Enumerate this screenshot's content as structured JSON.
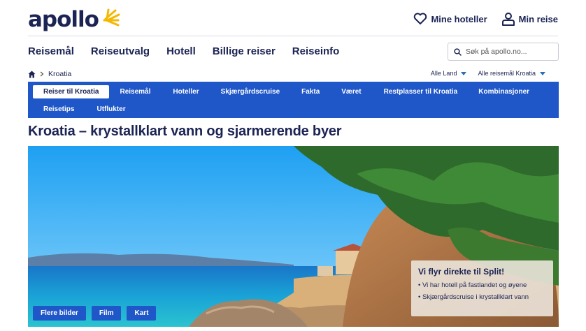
{
  "brand": {
    "name": "apollo"
  },
  "top_actions": [
    {
      "label": "Mine hoteller",
      "icon": "heart-icon"
    },
    {
      "label": "Min reise",
      "icon": "user-icon"
    }
  ],
  "main_nav": [
    "Reisemål",
    "Reiseutvalg",
    "Hotell",
    "Billige reiser",
    "Reiseinfo"
  ],
  "search": {
    "placeholder": "Søk på apollo.no..."
  },
  "breadcrumb": {
    "current": "Kroatia"
  },
  "filters": {
    "country": "Alle Land",
    "destination": "Alle reisemål Kroatia"
  },
  "sub_nav": {
    "row1": [
      "Reiser til Kroatia",
      "Reisemål",
      "Hoteller",
      "Skjærgårdscruise",
      "Fakta",
      "Været",
      "Restplasser til Kroatia",
      "Kombinasjoner"
    ],
    "row2": [
      "Reisetips",
      "Utflukter"
    ]
  },
  "page_title": "Kroatia – krystallklart vann og sjarmerende byer",
  "hero": {
    "buttons": [
      "Flere bilder",
      "Film",
      "Kart"
    ],
    "promo": {
      "title": "Vi flyr direkte til Split!",
      "items": [
        "Vi har hotell på fastlandet og øyene",
        "Skjærgårdscruise i krystallklart vann"
      ]
    }
  },
  "colors": {
    "brand_navy": "#1c2454",
    "nav_blue": "#1f56c8",
    "sun_yellow": "#f5b800"
  }
}
